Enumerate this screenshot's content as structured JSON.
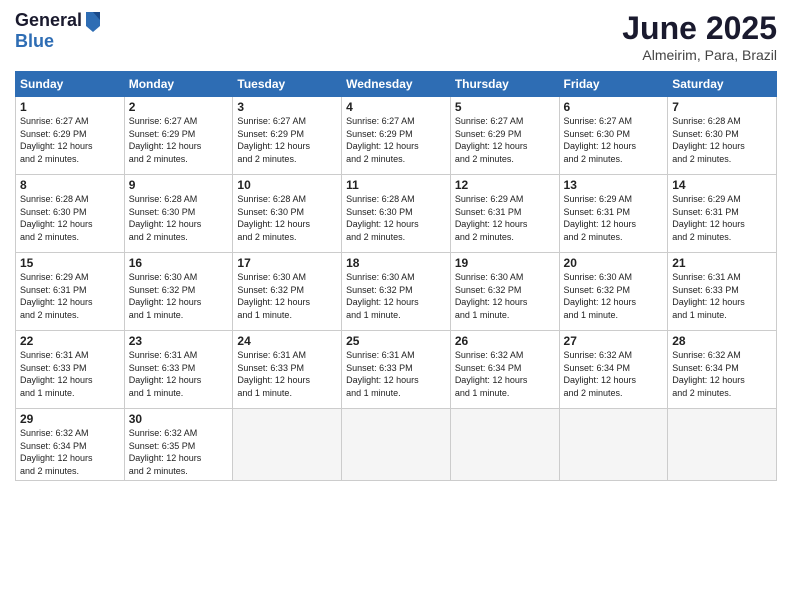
{
  "logo": {
    "general": "General",
    "blue": "Blue"
  },
  "title": {
    "month": "June 2025",
    "location": "Almeirim, Para, Brazil"
  },
  "headers": [
    "Sunday",
    "Monday",
    "Tuesday",
    "Wednesday",
    "Thursday",
    "Friday",
    "Saturday"
  ],
  "weeks": [
    [
      {
        "day": "1",
        "info": "Sunrise: 6:27 AM\nSunset: 6:29 PM\nDaylight: 12 hours\nand 2 minutes."
      },
      {
        "day": "2",
        "info": "Sunrise: 6:27 AM\nSunset: 6:29 PM\nDaylight: 12 hours\nand 2 minutes."
      },
      {
        "day": "3",
        "info": "Sunrise: 6:27 AM\nSunset: 6:29 PM\nDaylight: 12 hours\nand 2 minutes."
      },
      {
        "day": "4",
        "info": "Sunrise: 6:27 AM\nSunset: 6:29 PM\nDaylight: 12 hours\nand 2 minutes."
      },
      {
        "day": "5",
        "info": "Sunrise: 6:27 AM\nSunset: 6:29 PM\nDaylight: 12 hours\nand 2 minutes."
      },
      {
        "day": "6",
        "info": "Sunrise: 6:27 AM\nSunset: 6:30 PM\nDaylight: 12 hours\nand 2 minutes."
      },
      {
        "day": "7",
        "info": "Sunrise: 6:28 AM\nSunset: 6:30 PM\nDaylight: 12 hours\nand 2 minutes."
      }
    ],
    [
      {
        "day": "8",
        "info": "Sunrise: 6:28 AM\nSunset: 6:30 PM\nDaylight: 12 hours\nand 2 minutes."
      },
      {
        "day": "9",
        "info": "Sunrise: 6:28 AM\nSunset: 6:30 PM\nDaylight: 12 hours\nand 2 minutes."
      },
      {
        "day": "10",
        "info": "Sunrise: 6:28 AM\nSunset: 6:30 PM\nDaylight: 12 hours\nand 2 minutes."
      },
      {
        "day": "11",
        "info": "Sunrise: 6:28 AM\nSunset: 6:30 PM\nDaylight: 12 hours\nand 2 minutes."
      },
      {
        "day": "12",
        "info": "Sunrise: 6:29 AM\nSunset: 6:31 PM\nDaylight: 12 hours\nand 2 minutes."
      },
      {
        "day": "13",
        "info": "Sunrise: 6:29 AM\nSunset: 6:31 PM\nDaylight: 12 hours\nand 2 minutes."
      },
      {
        "day": "14",
        "info": "Sunrise: 6:29 AM\nSunset: 6:31 PM\nDaylight: 12 hours\nand 2 minutes."
      }
    ],
    [
      {
        "day": "15",
        "info": "Sunrise: 6:29 AM\nSunset: 6:31 PM\nDaylight: 12 hours\nand 2 minutes."
      },
      {
        "day": "16",
        "info": "Sunrise: 6:30 AM\nSunset: 6:32 PM\nDaylight: 12 hours\nand 1 minute."
      },
      {
        "day": "17",
        "info": "Sunrise: 6:30 AM\nSunset: 6:32 PM\nDaylight: 12 hours\nand 1 minute."
      },
      {
        "day": "18",
        "info": "Sunrise: 6:30 AM\nSunset: 6:32 PM\nDaylight: 12 hours\nand 1 minute."
      },
      {
        "day": "19",
        "info": "Sunrise: 6:30 AM\nSunset: 6:32 PM\nDaylight: 12 hours\nand 1 minute."
      },
      {
        "day": "20",
        "info": "Sunrise: 6:30 AM\nSunset: 6:32 PM\nDaylight: 12 hours\nand 1 minute."
      },
      {
        "day": "21",
        "info": "Sunrise: 6:31 AM\nSunset: 6:33 PM\nDaylight: 12 hours\nand 1 minute."
      }
    ],
    [
      {
        "day": "22",
        "info": "Sunrise: 6:31 AM\nSunset: 6:33 PM\nDaylight: 12 hours\nand 1 minute."
      },
      {
        "day": "23",
        "info": "Sunrise: 6:31 AM\nSunset: 6:33 PM\nDaylight: 12 hours\nand 1 minute."
      },
      {
        "day": "24",
        "info": "Sunrise: 6:31 AM\nSunset: 6:33 PM\nDaylight: 12 hours\nand 1 minute."
      },
      {
        "day": "25",
        "info": "Sunrise: 6:31 AM\nSunset: 6:33 PM\nDaylight: 12 hours\nand 1 minute."
      },
      {
        "day": "26",
        "info": "Sunrise: 6:32 AM\nSunset: 6:34 PM\nDaylight: 12 hours\nand 1 minute."
      },
      {
        "day": "27",
        "info": "Sunrise: 6:32 AM\nSunset: 6:34 PM\nDaylight: 12 hours\nand 2 minutes."
      },
      {
        "day": "28",
        "info": "Sunrise: 6:32 AM\nSunset: 6:34 PM\nDaylight: 12 hours\nand 2 minutes."
      }
    ],
    [
      {
        "day": "29",
        "info": "Sunrise: 6:32 AM\nSunset: 6:34 PM\nDaylight: 12 hours\nand 2 minutes."
      },
      {
        "day": "30",
        "info": "Sunrise: 6:32 AM\nSunset: 6:35 PM\nDaylight: 12 hours\nand 2 minutes."
      },
      {
        "day": "",
        "info": ""
      },
      {
        "day": "",
        "info": ""
      },
      {
        "day": "",
        "info": ""
      },
      {
        "day": "",
        "info": ""
      },
      {
        "day": "",
        "info": ""
      }
    ]
  ]
}
